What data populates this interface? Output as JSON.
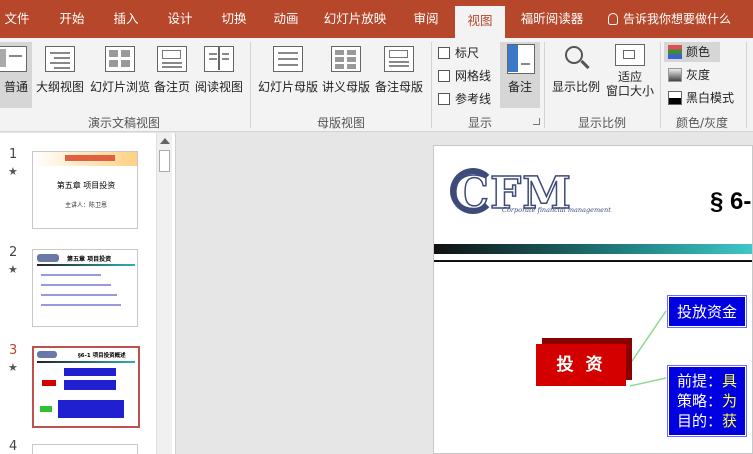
{
  "tabs": [
    {
      "label": "文件",
      "active": false
    },
    {
      "label": "开始",
      "active": false
    },
    {
      "label": "插入",
      "active": false
    },
    {
      "label": "设计",
      "active": false
    },
    {
      "label": "切换",
      "active": false
    },
    {
      "label": "动画",
      "active": false
    },
    {
      "label": "幻灯片放映",
      "active": false
    },
    {
      "label": "审阅",
      "active": false
    },
    {
      "label": "视图",
      "active": true
    },
    {
      "label": "福昕阅读器",
      "active": false
    }
  ],
  "tell_me": "告诉我你想要做什么",
  "ribbon": {
    "presentation_views": {
      "group_label": "演示文稿视图",
      "buttons": [
        "普通",
        "大纲视图",
        "幻灯片浏览",
        "备注页",
        "阅读视图"
      ]
    },
    "master_views": {
      "group_label": "母版视图",
      "buttons": [
        "幻灯片母版",
        "讲义母版",
        "备注母版"
      ]
    },
    "show": {
      "group_label": "显示",
      "checkboxes": [
        {
          "label": "标尺",
          "checked": false
        },
        {
          "label": "网格线",
          "checked": false
        },
        {
          "label": "参考线",
          "checked": false
        }
      ],
      "notes_button": "备注"
    },
    "zoom": {
      "group_label": "显示比例",
      "zoom_button": "显示比例",
      "fit_button_line1": "适应",
      "fit_button_line2": "窗口大小"
    },
    "color": {
      "group_label": "颜色/灰度",
      "options": [
        {
          "label": "颜色",
          "selected": true
        },
        {
          "label": "灰度",
          "selected": false
        },
        {
          "label": "黑白模式",
          "selected": false
        }
      ]
    }
  },
  "thumbnails": [
    {
      "number": "1",
      "star": "★",
      "active": false,
      "title": "第五章  项目投资",
      "subtitle": "主讲人：陈卫恩"
    },
    {
      "number": "2",
      "star": "★",
      "active": false,
      "title": "第五章  项目投资"
    },
    {
      "number": "3",
      "star": "★",
      "active": true,
      "title": "§6-1  项目投资概述"
    },
    {
      "number": "4",
      "star": "",
      "active": false
    }
  ],
  "slide": {
    "logo_text": "CFM",
    "logo_subtitle": "Corporate financial management",
    "title": "§ 6-",
    "invest_box": "投 资",
    "box1": "投放资金",
    "box2_line1_a": "前提：",
    "box2_line1_b": "具",
    "box2_line2_a": "策略：",
    "box2_line2_b": "为",
    "box2_line3_a": "目的：",
    "box2_line3_b": "获"
  },
  "colors": {
    "accent": "#b7472a",
    "invest_red": "#d40000",
    "box_blue": "#0000e0"
  }
}
